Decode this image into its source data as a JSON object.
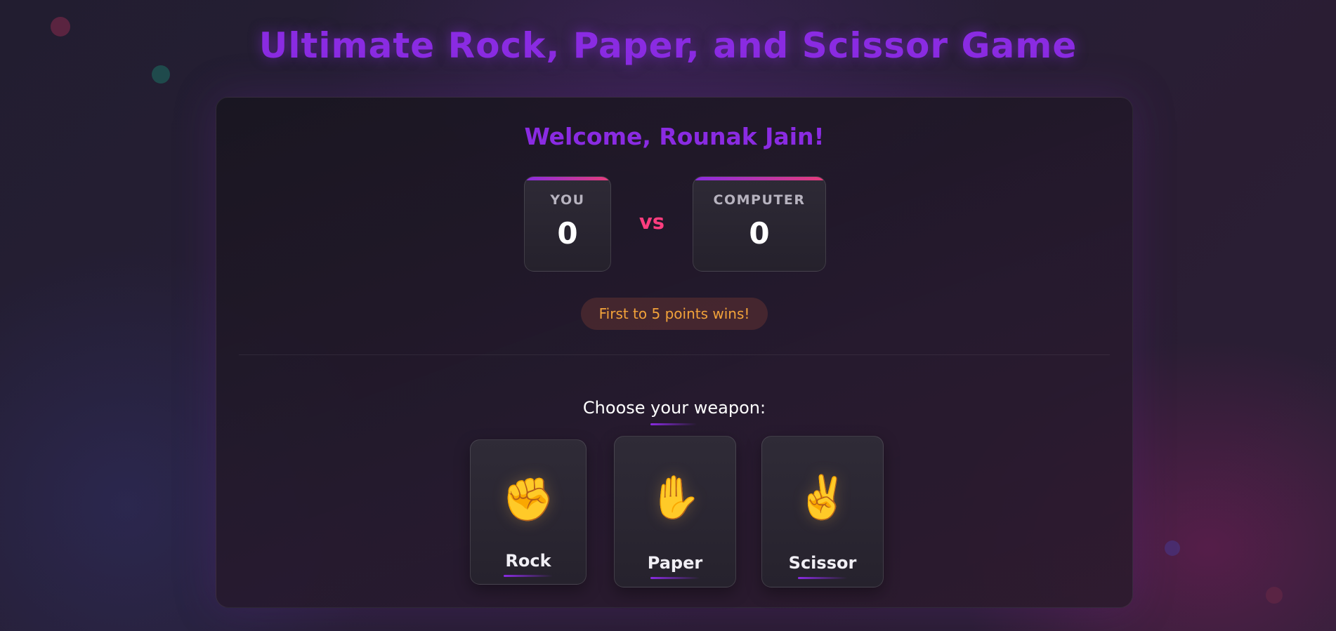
{
  "page": {
    "title": "Ultimate Rock, Paper, and Scissor Game"
  },
  "game": {
    "welcome": "Welcome, Rounak Jain!",
    "player": {
      "label": "YOU",
      "score": "0"
    },
    "computer": {
      "label": "COMPUTER",
      "score": "0"
    },
    "vs_label": "vs",
    "rule": "First to 5 points wins!",
    "choose_prompt": "Choose your weapon:",
    "weapons": [
      {
        "label": "Rock",
        "icon": "✊",
        "icon_name": "rock-fist-icon"
      },
      {
        "label": "Paper",
        "icon": "✋",
        "icon_name": "paper-hand-icon"
      },
      {
        "label": "Scissor",
        "icon": "✌️",
        "icon_name": "scissor-hand-icon"
      }
    ]
  },
  "colors": {
    "accent": "#8a2be2",
    "vs": "#ff3d7f",
    "rule_text": "#f2a23a"
  }
}
